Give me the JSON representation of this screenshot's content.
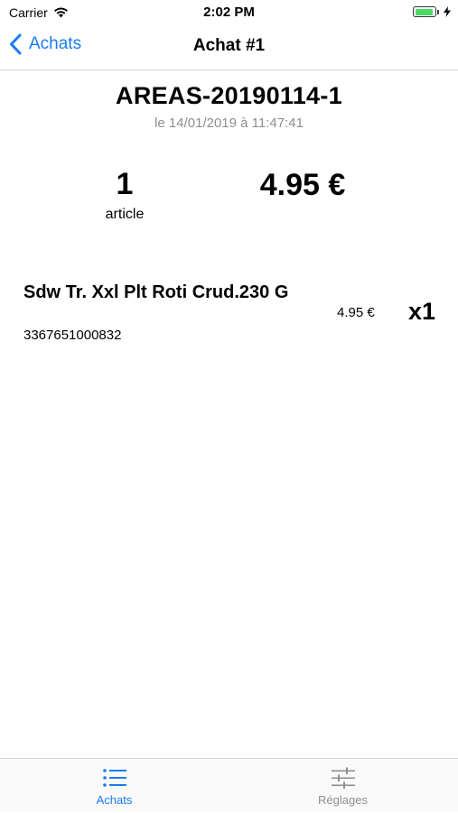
{
  "status_bar": {
    "carrier": "Carrier",
    "time": "2:02 PM"
  },
  "nav": {
    "back_label": "Achats",
    "title": "Achat #1"
  },
  "receipt": {
    "id": "AREAS-20190114-1",
    "date": "le 14/01/2019 à 11:47:41"
  },
  "summary": {
    "count": "1",
    "count_label": "article",
    "total": "4.95 €"
  },
  "items": [
    {
      "name": "Sdw Tr. Xxl Plt Roti Crud.230 G",
      "code": "3367651000832",
      "price": "4.95 €",
      "quantity": "x1"
    }
  ],
  "tabs": [
    {
      "label": "Achats",
      "icon": "list-icon",
      "active": true
    },
    {
      "label": "Réglages",
      "icon": "sliders-icon",
      "active": false
    }
  ],
  "colors": {
    "accent": "#1a7cf0",
    "secondary_text": "#8e8e93",
    "battery": "#4cd964"
  }
}
